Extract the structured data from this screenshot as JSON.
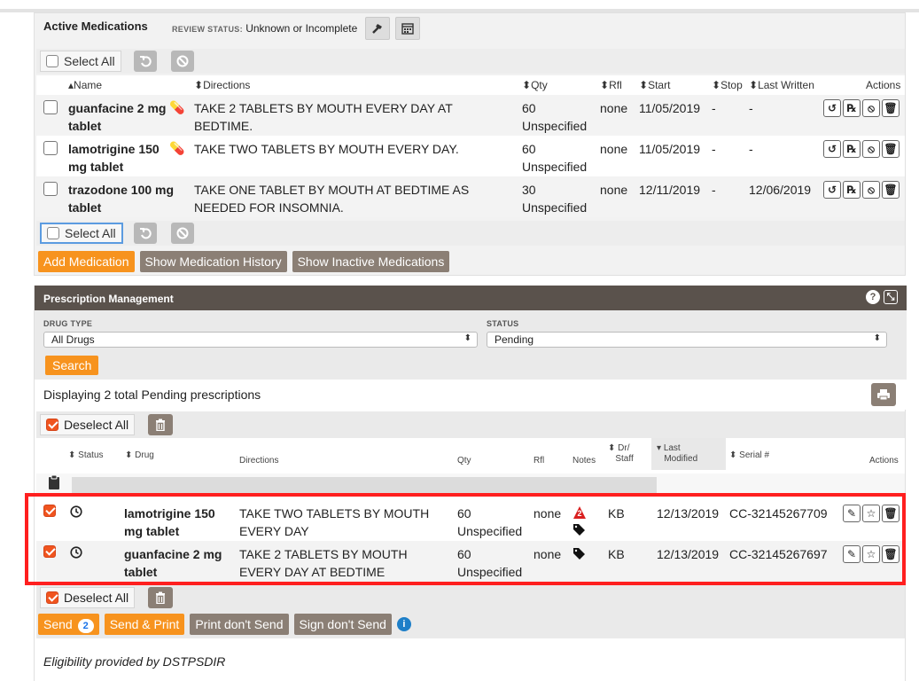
{
  "active_medications": {
    "title": "Active Medications",
    "review_caption": "REVIEW STATUS:",
    "review_value": "Unknown or Incomplete",
    "select_all": "Select All",
    "columns": {
      "name": "Name",
      "directions": "Directions",
      "qty": "Qty",
      "rfl": "Rfl",
      "start": "Start",
      "stop": "Stop",
      "last_written": "Last Written",
      "actions": "Actions"
    },
    "rows": [
      {
        "drug1": "guanfacine 2 mg",
        "drug2": "tablet",
        "dir1": "TAKE 2 TABLETS BY MOUTH EVERY DAY AT",
        "dir2": "BEDTIME.",
        "qty1": "60",
        "qty2": "Unspecified",
        "rfl": "none",
        "start": "11/05/2019",
        "stop": "-",
        "last": "-"
      },
      {
        "drug1": "lamotrigine 150",
        "drug2": "mg tablet",
        "dir1": "TAKE TWO TABLETS BY MOUTH EVERY DAY.",
        "dir2": "",
        "qty1": "60",
        "qty2": "Unspecified",
        "rfl": "none",
        "start": "11/05/2019",
        "stop": "-",
        "last": "-"
      },
      {
        "drug1": "trazodone 100 mg",
        "drug2": "tablet",
        "dir1": "TAKE ONE TABLET BY MOUTH AT BEDTIME AS",
        "dir2": "NEEDED FOR INSOMNIA.",
        "qty1": "30",
        "qty2": "Unspecified",
        "rfl": "none",
        "start": "12/11/2019",
        "stop": "-",
        "last": "12/06/2019"
      }
    ],
    "add_medication": "Add Medication",
    "show_history": "Show Medication History",
    "show_inactive": "Show Inactive Medications"
  },
  "prescription_management": {
    "title": "Prescription Management",
    "drug_type_label": "DRUG TYPE",
    "drug_type_value": "All Drugs",
    "status_label": "STATUS",
    "status_value": "Pending",
    "search": "Search",
    "displaying": "Displaying 2 total Pending prescriptions",
    "deselect_all": "Deselect All",
    "columns": {
      "status": "Status",
      "drug": "Drug",
      "directions": "Directions",
      "qty": "Qty",
      "rfl": "Rfl",
      "notes": "Notes",
      "dr1": "Dr/",
      "dr2": "Staff",
      "lm1": "Last",
      "lm2": "Modified",
      "serial": "Serial #",
      "actions": "Actions"
    },
    "rows": [
      {
        "drug1": "lamotrigine 150",
        "drug2": "mg tablet",
        "dir1": "TAKE TWO TABLETS BY MOUTH",
        "dir2": "EVERY DAY",
        "qty1": "60",
        "qty2": "Unspecified",
        "rfl": "none",
        "notes_badge": "2",
        "staff": "KB",
        "modified": "12/13/2019",
        "serial": "CC-32145267709"
      },
      {
        "drug1": "guanfacine 2 mg",
        "drug2": "tablet",
        "dir1": "TAKE 2 TABLETS BY MOUTH",
        "dir2": "EVERY DAY AT BEDTIME",
        "qty1": "60",
        "qty2": "Unspecified",
        "rfl": "none",
        "notes_badge": "",
        "staff": "KB",
        "modified": "12/13/2019",
        "serial": "CC-32145267697"
      }
    ],
    "send": "Send",
    "send_count": "2",
    "send_print": "Send & Print",
    "print_dont_send": "Print don't Send",
    "sign_dont_send": "Sign don't Send",
    "eligibility": "Eligibility provided by DSTPSDIR"
  },
  "colors": {
    "accent": "#f7931e",
    "brown": "#8b7f75",
    "highlight": "#ff1f1f",
    "header": "#5a524c"
  }
}
